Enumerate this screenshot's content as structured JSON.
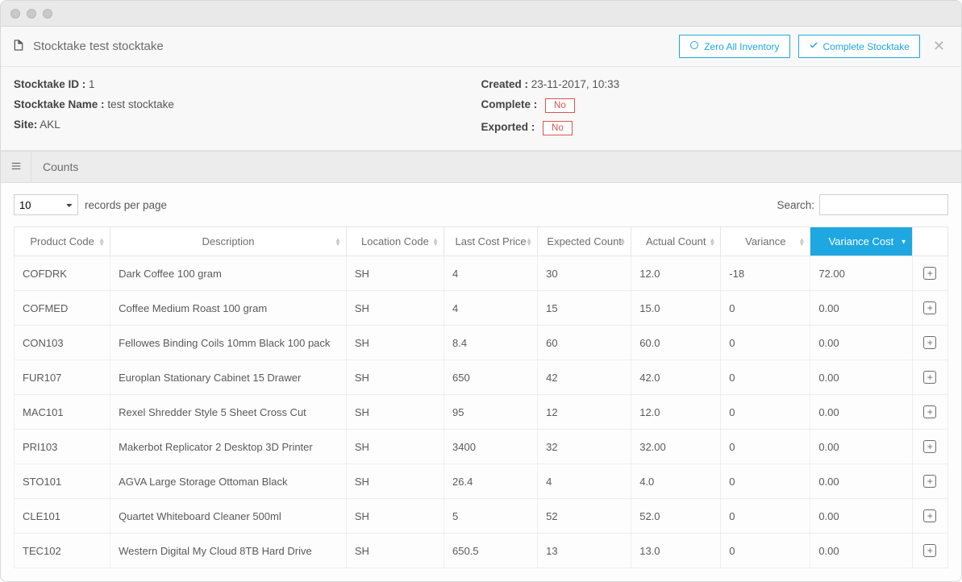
{
  "header": {
    "title": "Stocktake test stocktake",
    "zero_btn": "Zero All Inventory",
    "complete_btn": "Complete Stocktake"
  },
  "meta": {
    "id_label": "Stocktake ID :",
    "id_value": "1",
    "name_label": "Stocktake Name :",
    "name_value": "test stocktake",
    "site_label": "Site:",
    "site_value": "AKL",
    "created_label": "Created :",
    "created_value": "23-11-2017, 10:33",
    "complete_label": "Complete :",
    "complete_value": "No",
    "exported_label": "Exported :",
    "exported_value": "No"
  },
  "section": {
    "title": "Counts"
  },
  "table_controls": {
    "page_size": "10",
    "records_label": "records per page",
    "search_label": "Search:",
    "search_value": ""
  },
  "columns": {
    "product_code": "Product Code",
    "description": "Description",
    "location_code": "Location Code",
    "last_cost_price": "Last Cost Price",
    "expected_count": "Expected Count",
    "actual_count": "Actual Count",
    "variance": "Variance",
    "variance_cost": "Variance Cost"
  },
  "rows": [
    {
      "product_code": "COFDRK",
      "description": "Dark Coffee 100 gram",
      "location_code": "SH",
      "last_cost_price": "4",
      "expected_count": "30",
      "actual_count": "12.0",
      "variance": "-18",
      "variance_cost": "72.00"
    },
    {
      "product_code": "COFMED",
      "description": "Coffee Medium Roast 100 gram",
      "location_code": "SH",
      "last_cost_price": "4",
      "expected_count": "15",
      "actual_count": "15.0",
      "variance": "0",
      "variance_cost": "0.00"
    },
    {
      "product_code": "CON103",
      "description": "Fellowes Binding Coils 10mm Black 100 pack",
      "location_code": "SH",
      "last_cost_price": "8.4",
      "expected_count": "60",
      "actual_count": "60.0",
      "variance": "0",
      "variance_cost": "0.00"
    },
    {
      "product_code": "FUR107",
      "description": "Europlan Stationary Cabinet 15 Drawer",
      "location_code": "SH",
      "last_cost_price": "650",
      "expected_count": "42",
      "actual_count": "42.0",
      "variance": "0",
      "variance_cost": "0.00"
    },
    {
      "product_code": "MAC101",
      "description": "Rexel Shredder Style 5 Sheet Cross Cut",
      "location_code": "SH",
      "last_cost_price": "95",
      "expected_count": "12",
      "actual_count": "12.0",
      "variance": "0",
      "variance_cost": "0.00"
    },
    {
      "product_code": "PRI103",
      "description": "Makerbot Replicator 2 Desktop 3D Printer",
      "location_code": "SH",
      "last_cost_price": "3400",
      "expected_count": "32",
      "actual_count": "32.00",
      "variance": "0",
      "variance_cost": "0.00"
    },
    {
      "product_code": "STO101",
      "description": "AGVA Large Storage Ottoman Black",
      "location_code": "SH",
      "last_cost_price": "26.4",
      "expected_count": "4",
      "actual_count": "4.0",
      "variance": "0",
      "variance_cost": "0.00"
    },
    {
      "product_code": "CLE101",
      "description": "Quartet Whiteboard Cleaner 500ml",
      "location_code": "SH",
      "last_cost_price": "5",
      "expected_count": "52",
      "actual_count": "52.0",
      "variance": "0",
      "variance_cost": "0.00"
    },
    {
      "product_code": "TEC102",
      "description": "Western Digital My Cloud 8TB Hard Drive",
      "location_code": "SH",
      "last_cost_price": "650.5",
      "expected_count": "13",
      "actual_count": "13.0",
      "variance": "0",
      "variance_cost": "0.00"
    }
  ]
}
